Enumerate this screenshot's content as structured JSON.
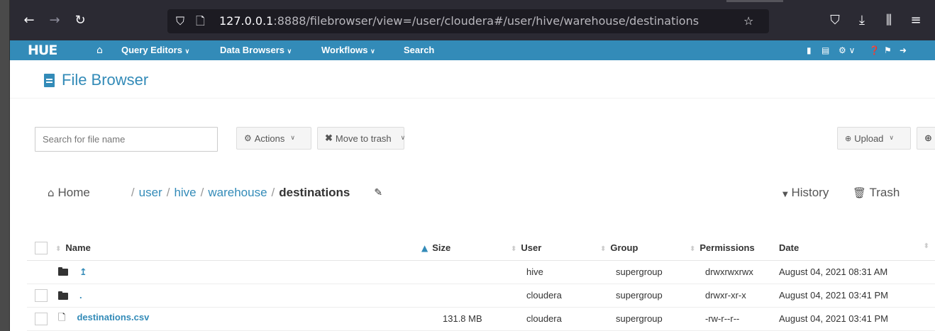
{
  "browser": {
    "url_host": "127.0.0.1",
    "url_rest": ":8888/filebrowser/view=/user/cloudera#/user/hive/warehouse/destinations"
  },
  "nav": {
    "logo": "HUE",
    "items": [
      "Query Editors",
      "Data Browsers",
      "Workflows",
      "Search"
    ]
  },
  "page": {
    "title": "File Browser"
  },
  "toolbar": {
    "search_placeholder": "Search for file name",
    "actions_label": "Actions",
    "move_to_trash_label": "Move to trash",
    "upload_label": "Upload"
  },
  "breadcrumb": {
    "home": "Home",
    "parts": [
      "user",
      "hive",
      "warehouse"
    ],
    "current": "destinations",
    "history": "History",
    "trash": "Trash"
  },
  "table": {
    "headers": {
      "name": "Name",
      "size": "Size",
      "user": "User",
      "group": "Group",
      "permissions": "Permissions",
      "date": "Date"
    },
    "rows": [
      {
        "name": "↥",
        "size": "",
        "user": "hive",
        "group": "supergroup",
        "permissions": "drwxrwxrwx",
        "date": "August 04, 2021 08:31 AM"
      },
      {
        "name": ".",
        "size": "",
        "user": "cloudera",
        "group": "supergroup",
        "permissions": "drwxr-xr-x",
        "date": "August 04, 2021 03:41 PM"
      },
      {
        "name": "destinations.csv",
        "size": "131.8 MB",
        "user": "cloudera",
        "group": "supergroup",
        "permissions": "-rw-r--r--",
        "date": "August 04, 2021 03:41 PM"
      }
    ]
  }
}
